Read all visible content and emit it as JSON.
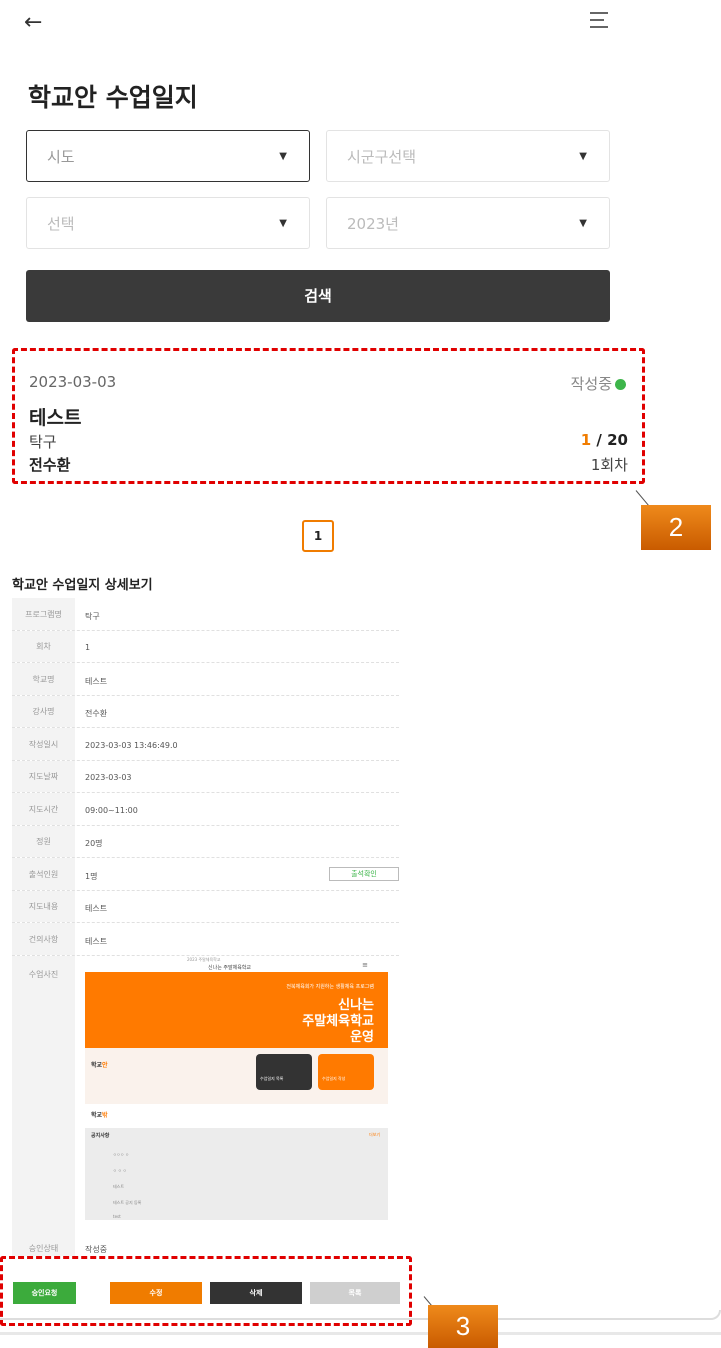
{
  "header": {
    "back_icon": "←",
    "menu_icon": "hamburger"
  },
  "page_title": "학교안 수업일지",
  "filters": {
    "sido": {
      "value": "시도"
    },
    "sigungu": {
      "value": "시군구선택"
    },
    "school": {
      "value": "선택"
    },
    "year": {
      "value": "2023년"
    },
    "search_label": "검색"
  },
  "result_card": {
    "date": "2023-03-03",
    "status": "작성중",
    "status_color": "#3db54a",
    "name": "테스트",
    "sport": "탁구",
    "count_current": "1",
    "count_total": "/ 20",
    "instructor": "전수환",
    "round": "1회차"
  },
  "pagination": {
    "current": "1"
  },
  "callouts": {
    "two": "2",
    "three": "3"
  },
  "detail": {
    "title": "학교안 수업일지 상세보기",
    "rows": [
      {
        "label": "프로그램명",
        "value": "탁구"
      },
      {
        "label": "회차",
        "value": "1"
      },
      {
        "label": "학교명",
        "value": "테스트"
      },
      {
        "label": "강사명",
        "value": "전수환"
      },
      {
        "label": "작성일시",
        "value": "2023-03-03 13:46:49.0"
      },
      {
        "label": "지도날짜",
        "value": "2023-03-03"
      },
      {
        "label": "지도시간",
        "value": "09:00~11:00"
      },
      {
        "label": "정원",
        "value": "20명"
      },
      {
        "label": "출석인원",
        "value": "1명",
        "button": "출석확인"
      },
      {
        "label": "지도내용",
        "value": "테스트"
      },
      {
        "label": "건의사항",
        "value": "테스트"
      },
      {
        "label": "수업사진",
        "value": ""
      },
      {
        "label": "승인상태",
        "value": "작성중"
      }
    ]
  },
  "photo": {
    "header_small": "2023 주말체육학교",
    "header_title": "신나는 주말체육학교",
    "banner_sub": "전북체육회가 지원하는 생활체육 프로그램",
    "banner_big_1": "신나는",
    "banner_big_2": "주말체육학교",
    "banner_big_3": "운영",
    "section1_label_a": "학교",
    "section1_label_b": "안",
    "card_dark": "수업일지 목록",
    "card_orange": "수업일지 작성",
    "section2_label_a": "학교",
    "section2_label_b": "밖",
    "notice_title": "공지사항",
    "notice_more": "더보기",
    "notice_items": [
      "ㅇㅇㅇ ㅇ",
      "ㅇ ㅇ ㅇ",
      "테스트",
      "테스트 공지 등록",
      "test"
    ]
  },
  "actions": {
    "approve_request": "승인요청",
    "edit": "수정",
    "delete": "삭제",
    "list": "목록"
  }
}
